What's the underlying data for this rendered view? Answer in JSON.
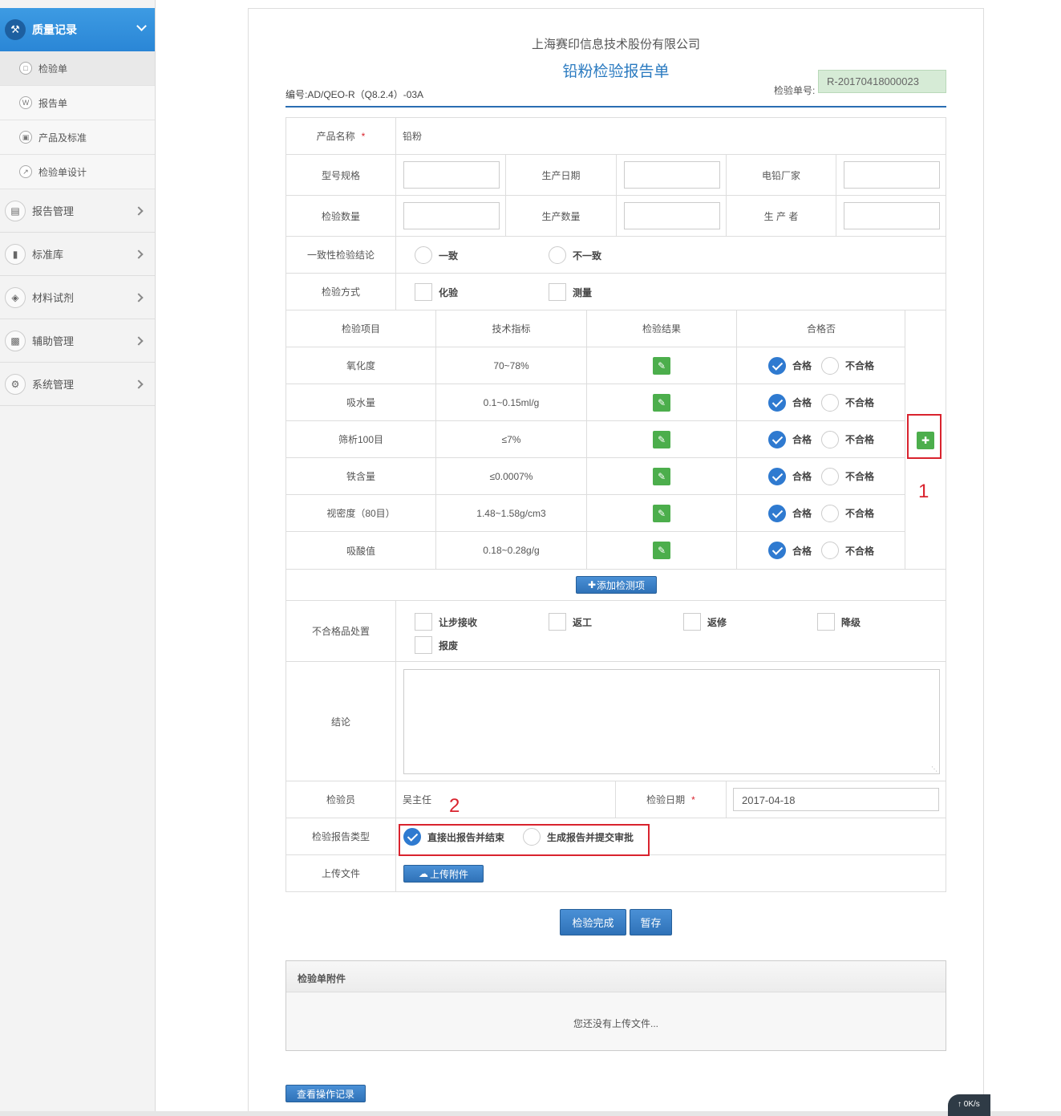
{
  "sidebar": {
    "active": {
      "label": "质量记录",
      "icon": "hammer-icon"
    },
    "subitems": [
      {
        "label": "检验单",
        "icon": "document-icon"
      },
      {
        "label": "报告单",
        "icon": "word-doc-icon"
      },
      {
        "label": "产品及标准",
        "icon": "cube-icon"
      },
      {
        "label": "检验单设计",
        "icon": "wrench-icon"
      }
    ],
    "menus": [
      {
        "label": "报告管理",
        "icon": "report-icon"
      },
      {
        "label": "标准库",
        "icon": "book-icon"
      },
      {
        "label": "材料试剂",
        "icon": "cubes-icon"
      },
      {
        "label": "辅助管理",
        "icon": "briefcase-icon"
      },
      {
        "label": "系统管理",
        "icon": "gears-icon"
      }
    ]
  },
  "header": {
    "company": "上海赛印信息技术股份有限公司",
    "title": "铅粉检验报告单",
    "doc_no": "编号:AD/QEO-R（Q8.2.4）-03A",
    "insp_no_label": "检验单号:",
    "insp_no": "R-20170418000023"
  },
  "form": {
    "product_label": "产品名称",
    "required_mark": "*",
    "product_value": "铅粉",
    "model_label": "型号规格",
    "prod_date_label": "生产日期",
    "maker_label": "电铅厂家",
    "qty_label": "检验数量",
    "prod_qty_label": "生产数量",
    "producer_label": "生 产 者",
    "consistency_label": "一致性检验结论",
    "consistency_options": [
      "一致",
      "不一致"
    ],
    "method_label": "检验方式",
    "method_options": [
      "化验",
      "测量"
    ]
  },
  "items": {
    "headers": [
      "检验项目",
      "技术指标",
      "检验结果",
      "合格否"
    ],
    "pass_label": "合格",
    "fail_label": "不合格",
    "rows": [
      {
        "name": "氧化度",
        "spec": "70~78%"
      },
      {
        "name": "吸水量",
        "spec": "0.1~0.15ml/g"
      },
      {
        "name": "筛析100目",
        "spec": "≤7%"
      },
      {
        "name": "铁含量",
        "spec": "≤0.0007%"
      },
      {
        "name": "视密度（80目）",
        "spec": "1.48~1.58g/cm3"
      },
      {
        "name": "吸酸值",
        "spec": "0.18~0.28g/g"
      }
    ],
    "add_button": "添加检测项"
  },
  "disposal": {
    "label": "不合格品处置",
    "options": [
      "让步接收",
      "返工",
      "返修",
      "降级",
      "报废"
    ]
  },
  "conclusion": {
    "label": "结论"
  },
  "inspector": {
    "label": "检验员",
    "value": "吴主任",
    "date_label": "检验日期",
    "date_value": "2017-04-18"
  },
  "report_type": {
    "label": "检验报告类型",
    "options": [
      "直接出报告并结束",
      "生成报告并提交审批"
    ]
  },
  "upload": {
    "label": "上传文件",
    "button": "上传附件"
  },
  "actions": {
    "complete": "检验完成",
    "save": "暂存"
  },
  "attachments": {
    "title": "检验单附件",
    "empty": "您还没有上传文件..."
  },
  "log_button": "查看操作记录",
  "annotations": [
    "1",
    "2"
  ],
  "speed": "0K/s",
  "colors": {
    "accent": "#2a86d6",
    "green": "#4cae4c",
    "annotation_red": "#d9232e",
    "insp_no_bg": "#d6ebd6"
  }
}
